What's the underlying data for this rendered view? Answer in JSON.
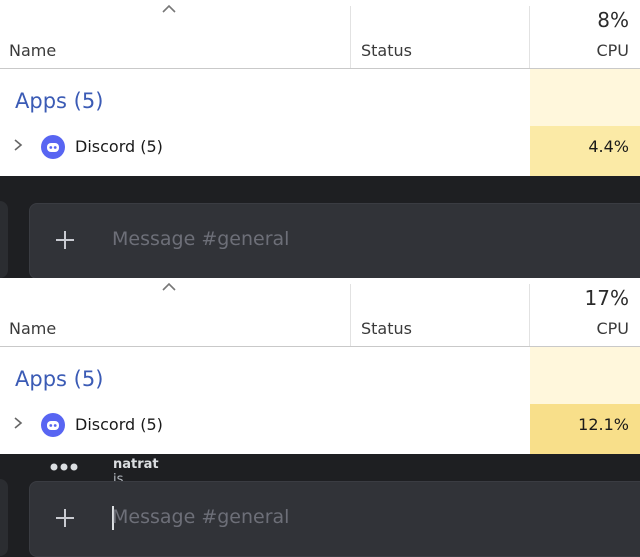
{
  "frames": [
    {
      "task_manager": {
        "columns": {
          "name": "Name",
          "status": "Status",
          "cpu": "CPU"
        },
        "cpu_total": "8%",
        "group_label": "Apps (5)",
        "row": {
          "label": "Discord (5)",
          "cpu": "4.4%"
        }
      },
      "discord": {
        "placeholder": "Message #general",
        "typing": null
      }
    },
    {
      "task_manager": {
        "columns": {
          "name": "Name",
          "status": "Status",
          "cpu": "CPU"
        },
        "cpu_total": "17%",
        "group_label": "Apps (5)",
        "row": {
          "label": "Discord (5)",
          "cpu": "12.1%"
        }
      },
      "discord": {
        "placeholder": "Message #general",
        "typing": {
          "user": "natrat",
          "text": " is typing..."
        }
      }
    }
  ],
  "colors": {
    "discord_brand": "#5865f2",
    "apps_group": "#3b5bb5",
    "cpu_heat_low": "#fff7dc",
    "cpu_heat_high": "#fbeaa6"
  },
  "icons": {
    "sort": "chevron-up-icon",
    "expand": "chevron-right-icon",
    "app": "discord-icon",
    "attach": "plus-icon",
    "typing": "typing-dots-icon"
  }
}
